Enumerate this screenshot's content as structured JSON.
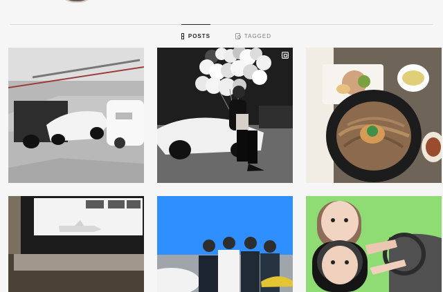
{
  "profile": {
    "avatar_label": ""
  },
  "tabs": [
    {
      "label": "POSTS",
      "icon": "grid-icon"
    },
    {
      "label": "TAGGED",
      "icon": "tag-icon"
    }
  ],
  "posts": [
    {
      "icon": "garage-cars-image"
    },
    {
      "icon": "balloons-supercar-image",
      "badge_icon": "multiple-posts-icon"
    },
    {
      "icon": "noodle-meal-image"
    },
    {
      "icon": "airplane-screen-image"
    },
    {
      "icon": "airport-group-image"
    },
    {
      "icon": "car-selfie-image"
    }
  ]
}
